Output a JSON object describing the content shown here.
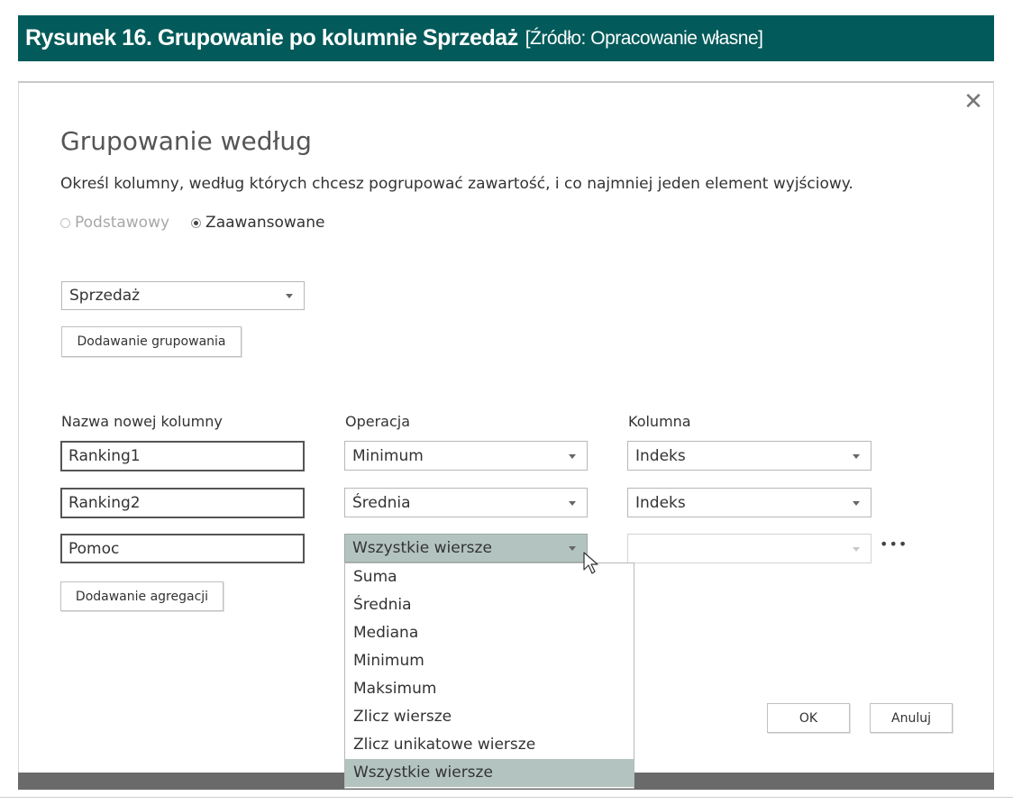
{
  "caption": {
    "bold": "Rysunek 16. Grupowanie po kolumnie Sprzedaż",
    "source": "[Źródło: Opracowanie własne]"
  },
  "dialog": {
    "close_glyph": "✕",
    "title": "Grupowanie według",
    "subtitle": "Określ kolumny, według których chcesz pogrupować zawartość, i co najmniej jeden element wyjściowy.",
    "radio_basic": "Podstawowy",
    "radio_advanced": "Zaawansowane",
    "group_by_select": "Sprzedaż",
    "add_grouping_button": "Dodawanie grupowania",
    "col_headers": {
      "new_column": "Nazwa nowej kolumny",
      "operation": "Operacja",
      "column": "Kolumna"
    },
    "rows": [
      {
        "name": "Ranking1",
        "operation": "Minimum",
        "column": "Indeks"
      },
      {
        "name": "Ranking2",
        "operation": "Średnia",
        "column": "Indeks"
      },
      {
        "name": "Pomoc",
        "operation": "Wszystkie wiersze",
        "column": ""
      }
    ],
    "more_glyph": "•••",
    "add_aggregation_button": "Dodawanie agregacji",
    "dropdown_options": [
      "Suma",
      "Średnia",
      "Mediana",
      "Minimum",
      "Maksimum",
      "Zlicz wiersze",
      "Zlicz unikatowe wiersze",
      "Wszystkie wiersze"
    ],
    "ok_button": "OK",
    "cancel_button": "Anuluj"
  },
  "colors": {
    "caption_bg": "#035a5a",
    "selected_bg": "#b3c4c0"
  }
}
